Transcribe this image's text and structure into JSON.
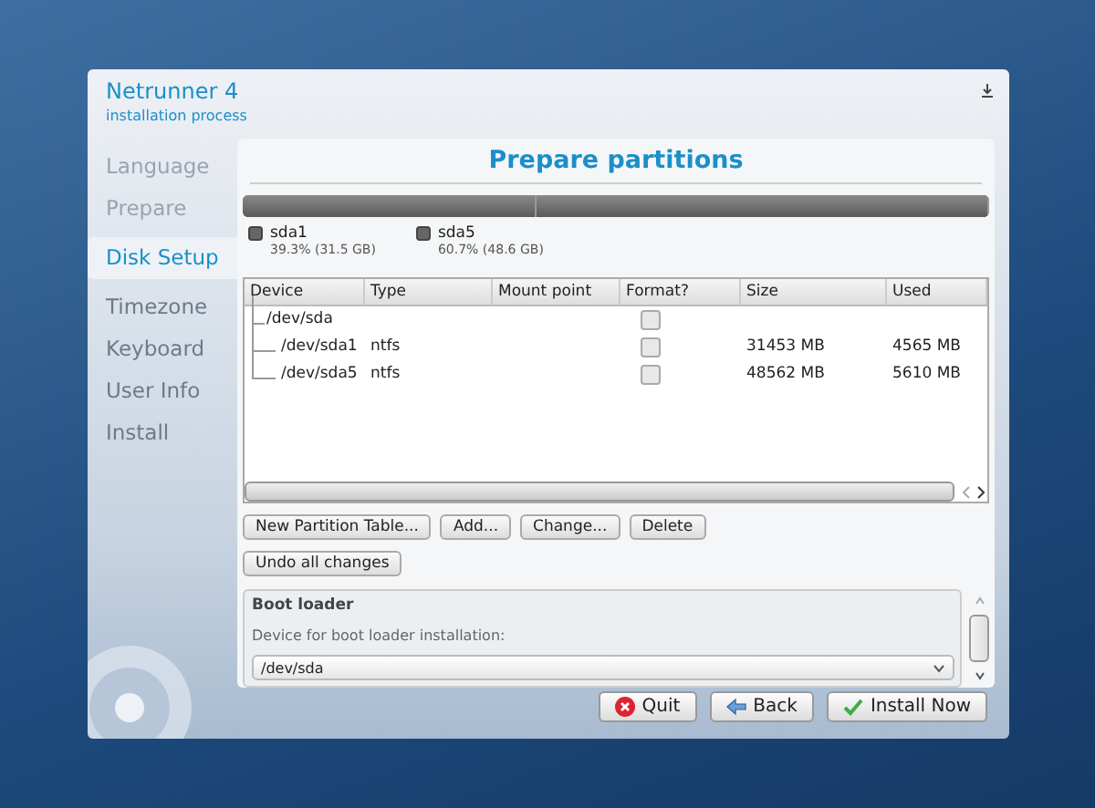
{
  "window": {
    "title": "Netrunner 4",
    "subtitle": "installation process"
  },
  "steps": [
    {
      "label": "Language",
      "selected": false,
      "done": true
    },
    {
      "label": "Prepare",
      "selected": false,
      "done": true
    },
    {
      "label": "Disk Setup",
      "selected": true,
      "done": false
    },
    {
      "label": "Timezone",
      "selected": false,
      "done": false
    },
    {
      "label": "Keyboard",
      "selected": false,
      "done": false
    },
    {
      "label": "User Info",
      "selected": false,
      "done": false
    },
    {
      "label": "Install",
      "selected": false,
      "done": false
    }
  ],
  "page_title": "Prepare partitions",
  "partition_bar": [
    {
      "level": 0.393
    },
    {
      "level": 0.607
    }
  ],
  "legend": [
    {
      "name": "sda1",
      "detail": "39.3% (31.5 GB)",
      "color": "#666666"
    },
    {
      "name": "sda5",
      "detail": "60.7% (48.6 GB)",
      "color": "#666666"
    }
  ],
  "table": {
    "columns": [
      "Device",
      "Type",
      "Mount point",
      "Format?",
      "Size",
      "Used"
    ],
    "rows": [
      {
        "device": "/dev/sda",
        "format_checked": false,
        "children": [
          {
            "device": "/dev/sda1",
            "type": "ntfs",
            "format_checked": false,
            "size": "31453 MB",
            "used": "4565 MB"
          },
          {
            "device": "/dev/sda5",
            "type": "ntfs",
            "format_checked": false,
            "size": "48562 MB",
            "used": "5610 MB"
          }
        ]
      }
    ]
  },
  "partition_buttons": [
    "New Partition Table...",
    "Add...",
    "Change...",
    "Delete"
  ],
  "undo_button": "Undo all changes",
  "boot_loader": {
    "title": "Boot loader",
    "label": "Device for boot loader installation:",
    "value": "/dev/sda"
  },
  "nav_buttons": [
    {
      "label": "Quit",
      "kind": "quit"
    },
    {
      "label": "Back",
      "kind": "back"
    },
    {
      "label": "Install Now",
      "kind": "install"
    }
  ]
}
